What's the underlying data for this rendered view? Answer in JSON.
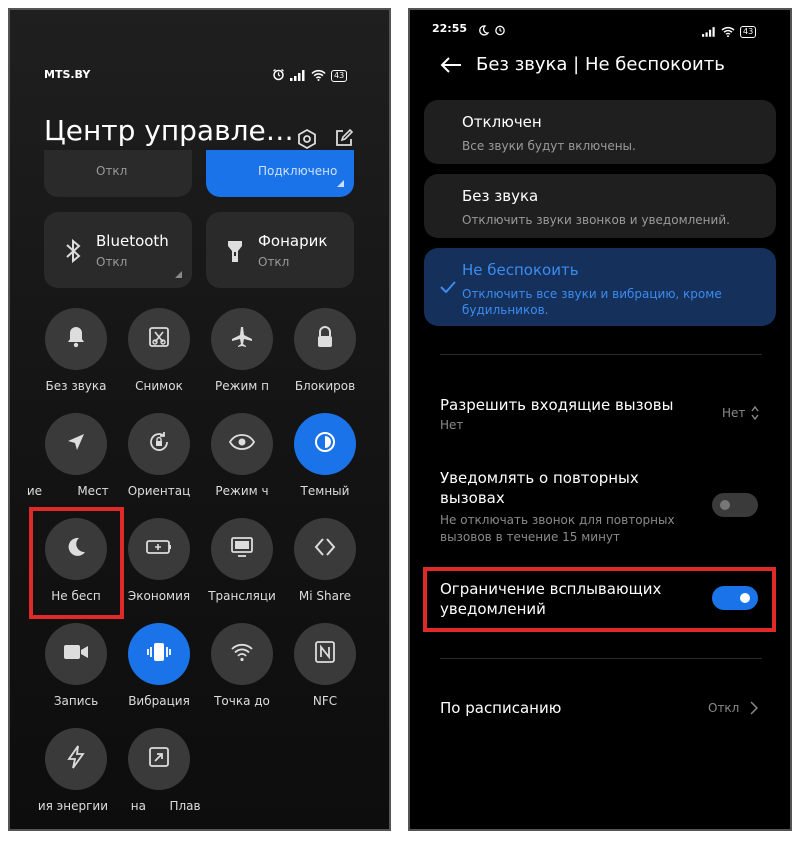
{
  "left": {
    "status": {
      "carrier": "MTS.BY",
      "battery": "43"
    },
    "title": "Центр управле…",
    "tiles_top": {
      "left_sub": "Откл",
      "right_sub": "Подключено"
    },
    "tiles": [
      {
        "label": "Bluetooth",
        "sub": "Откл"
      },
      {
        "label": "Фонарик",
        "sub": "Откл"
      }
    ],
    "buttons": [
      "Без звука",
      "Снимок",
      "Режим п",
      "Блокиров",
      "ие",
      "Мест",
      "Ориентац",
      "Режим ч",
      "Темный",
      "Не бесп",
      "Экономия",
      "Трансляци",
      "Mi Share",
      "Запись",
      "Вибрация",
      "Точка до",
      "NFC",
      "ия энергии",
      "на",
      "Плав"
    ]
  },
  "right": {
    "status": {
      "time": "22:55",
      "battery": "43"
    },
    "header": {
      "title": "Без звука | Не беспокоить"
    },
    "options": [
      {
        "title": "Отключен",
        "sub": "Все звуки будут включены."
      },
      {
        "title": "Без звука",
        "sub": "Отключить звуки звонков и уведомлений."
      },
      {
        "title": "Не беспокоить",
        "sub": "Отключить все звуки и вибрацию, кроме будильников."
      }
    ],
    "calls": {
      "title": "Разрешить входящие вызовы",
      "sub": "Нет",
      "value": "Нет"
    },
    "repeat": {
      "title": "Уведомлять о повторных вызовах",
      "sub": "Не отключать звонок для повторных вызовов в течение 15 минут"
    },
    "popup": {
      "title": "Ограничение всплывающих уведомлений"
    },
    "schedule": {
      "title": "По расписанию",
      "value": "Откл"
    }
  },
  "colors": {
    "accent": "#1a73e8",
    "highlight": "#e02a2a",
    "selected_bg": "#15305a"
  }
}
